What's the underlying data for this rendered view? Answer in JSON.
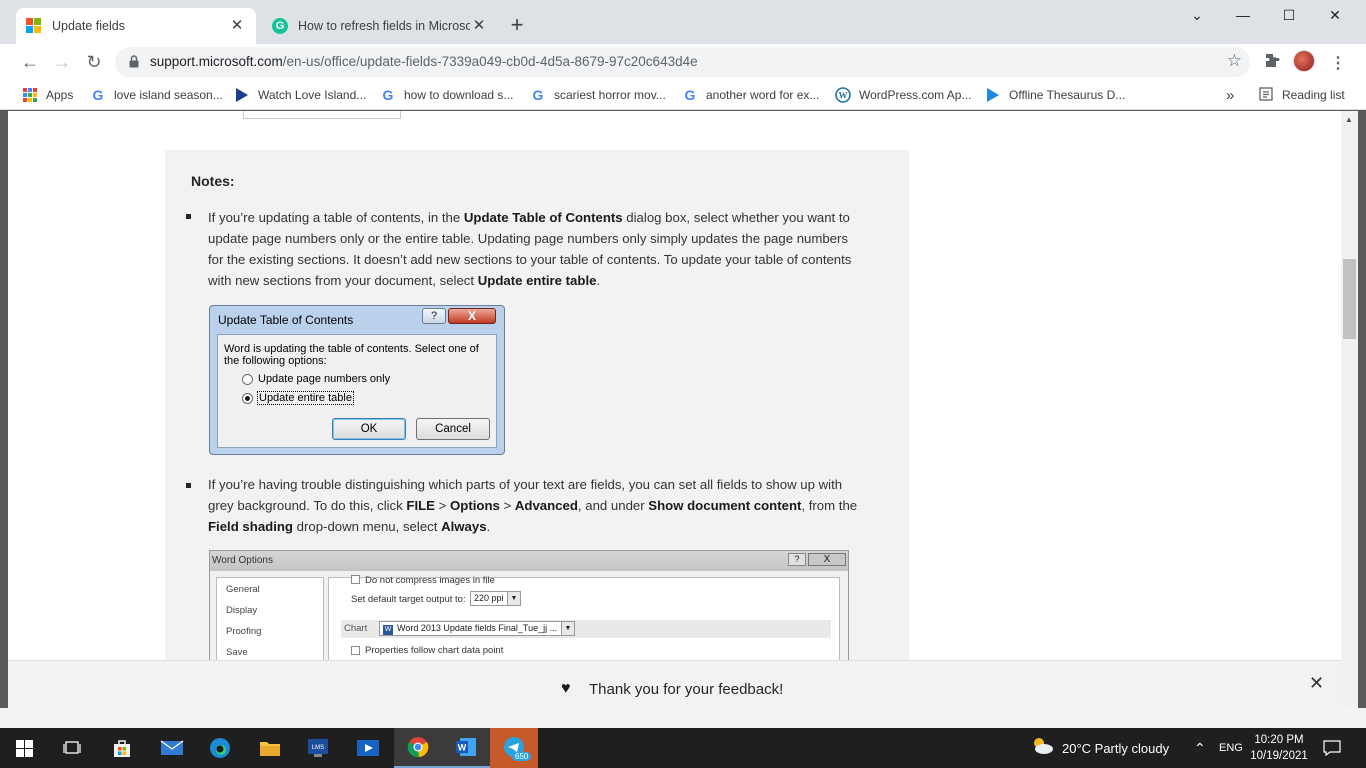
{
  "browser": {
    "tabs": [
      {
        "title": "Update fields",
        "active": true
      },
      {
        "title": "How to refresh fields in Microsoft Word",
        "active": false
      }
    ],
    "new_tab_symbol": "+",
    "url_domain": "support.microsoft.com",
    "url_path": "/en-us/office/update-fields-7339a049-cb0d-4d5a-8679-97c20c643d4e",
    "bookmarks": [
      {
        "label": "Apps",
        "icon": "apps-grid-icon"
      },
      {
        "label": "love island season...",
        "icon": "google-icon"
      },
      {
        "label": "Watch Love Island...",
        "icon": "play-icon"
      },
      {
        "label": "how to download s...",
        "icon": "google-icon"
      },
      {
        "label": "scariest horror mov...",
        "icon": "google-icon"
      },
      {
        "label": "another word for ex...",
        "icon": "google-icon"
      },
      {
        "label": "WordPress.com Ap...",
        "icon": "wordpress-icon"
      },
      {
        "label": "Offline Thesaurus D...",
        "icon": "play-icon"
      }
    ],
    "overflow_symbol": "»",
    "reading_list": "Reading list"
  },
  "article": {
    "notes_title": "Notes:",
    "note1": {
      "t1": "If you’re updating a table of contents, in the ",
      "b1": "Update Table of Contents",
      "t2": " dialog box, select whether you want to update page numbers only or the entire table. Updating page numbers only simply updates the page numbers for the existing sections. It doesn’t add new sections to your table of contents. To update your table of contents with new sections from your document, select ",
      "b2": "Update entire table",
      "t3": "."
    },
    "toc_dialog": {
      "title": "Update Table of Contents",
      "help": "?",
      "close": "X",
      "message": "Word is updating the table of contents.  Select one of the following options:",
      "option1": "Update page numbers only",
      "option2": "Update entire table",
      "selected": "Update entire table",
      "ok": "OK",
      "cancel": "Cancel"
    },
    "note2": {
      "t1": "If you’re having trouble distinguishing which parts of your text are fields, you can set all fields to show up with grey background. To do this, click ",
      "b1": "FILE",
      "t2": " > ",
      "b2": "Options",
      "t3": " > ",
      "b3": "Advanced",
      "t4": ", and under ",
      "b4": "Show document content",
      "t5": ", from the ",
      "b5": "Field shading",
      "t6": " drop-down menu, select ",
      "b6": "Always",
      "t7": "."
    },
    "word_options": {
      "title": "Word Options",
      "help": "?",
      "close": "X",
      "sidebar": [
        "General",
        "Display",
        "Proofing",
        "Save"
      ],
      "row_compress": "Do not compress images in file",
      "row_target_label": "Set default target output to:",
      "row_target_value": "220 ppi",
      "chart_label": "Chart",
      "chart_value": "Word 2013 Update fields Final_Tue_jj ...",
      "row_properties": "Properties follow chart data point"
    }
  },
  "feedback": {
    "message": "Thank you for your feedback!"
  },
  "taskbar": {
    "weather": "20°C  Partly cloudy",
    "language": "ENG",
    "time": "10:20 PM",
    "date": "10/19/2021",
    "telegram_badge": "650"
  }
}
